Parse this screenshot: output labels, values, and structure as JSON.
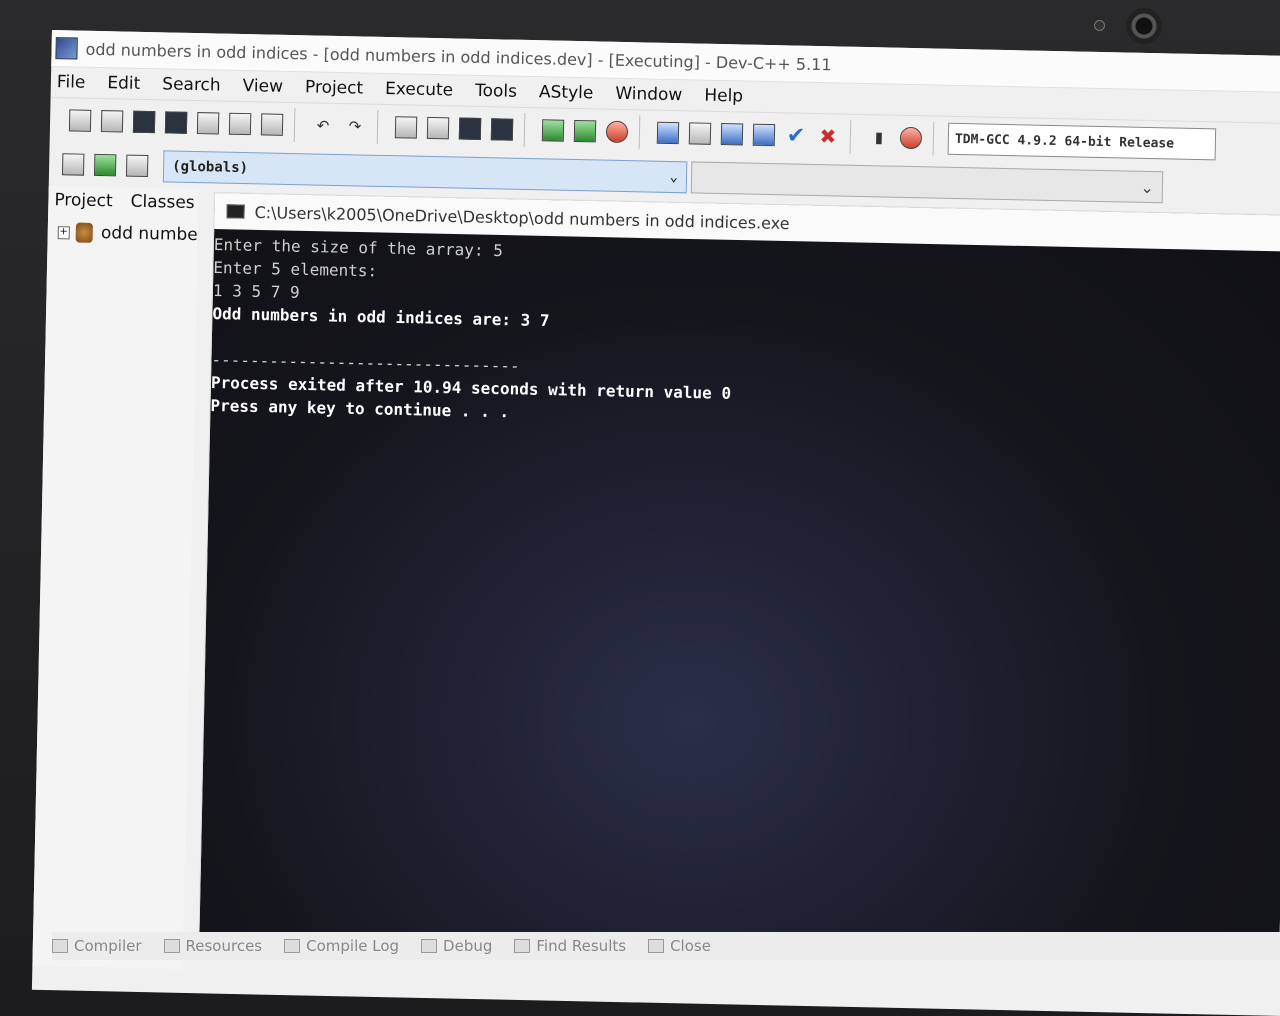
{
  "window": {
    "title": "odd numbers in odd indices - [odd numbers in odd indices.dev] - [Executing] - Dev-C++ 5.11"
  },
  "menu": [
    "File",
    "Edit",
    "Search",
    "View",
    "Project",
    "Execute",
    "Tools",
    "AStyle",
    "Window",
    "Help"
  ],
  "toolbar": {
    "compiler": "TDM-GCC 4.9.2 64-bit Release",
    "scope": "(globals)"
  },
  "left_pane": {
    "tabs": [
      "Project",
      "Classes"
    ],
    "tree_item": "odd numbe"
  },
  "console": {
    "title": "C:\\Users\\k2005\\OneDrive\\Desktop\\odd numbers in odd indices.exe",
    "lines": [
      "Enter the size of the array: 5",
      "Enter 5 elements:",
      "1 3 5 7 9",
      "Odd numbers in odd indices are: 3 7",
      "",
      "--------------------------------",
      "Process exited after 10.94 seconds with return value 0",
      "Press any key to continue . . ."
    ]
  },
  "statusbar": [
    "Compiler",
    "Resources",
    "Compile Log",
    "Debug",
    "Find Results",
    "Close"
  ]
}
